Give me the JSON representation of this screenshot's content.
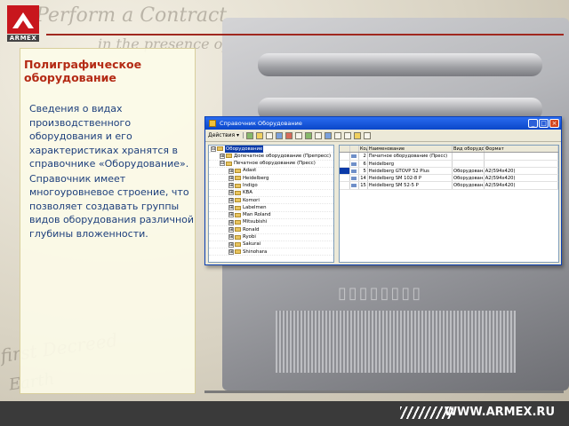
{
  "logo": {
    "name": "ARMEX"
  },
  "slide": {
    "title": "Полиграфическое оборудование",
    "paragraph1": "Сведения о видах производственного оборудования и его характеристиках хранятся в справочнике «Оборудование».",
    "paragraph2": "Справочник имеет многоуровневое строение, что позволяет создавать группы видов оборудования различной глубины вложенности."
  },
  "window": {
    "title": "Справочник Оборудование",
    "controls": [
      "_",
      "□",
      "×"
    ],
    "toolbar": {
      "actions_label": "Действия ▾"
    },
    "tree": [
      {
        "label": "Оборудование",
        "level": 0,
        "toggle": "⊟",
        "selected": true
      },
      {
        "label": "Допечатное оборудование (Препресс)",
        "level": 1,
        "toggle": "⊞"
      },
      {
        "label": "Печатное оборудование (Пресс)",
        "level": 1,
        "toggle": "⊟"
      },
      {
        "label": "Adast",
        "level": 2,
        "toggle": "⊞"
      },
      {
        "label": "Heidelberg",
        "level": 2,
        "toggle": "⊞"
      },
      {
        "label": "Indigo",
        "level": 2,
        "toggle": "⊞"
      },
      {
        "label": "KBA",
        "level": 2,
        "toggle": "⊞"
      },
      {
        "label": "Komori",
        "level": 2,
        "toggle": "⊞"
      },
      {
        "label": "Labelmen",
        "level": 2,
        "toggle": "⊞"
      },
      {
        "label": "Man Roland",
        "level": 2,
        "toggle": "⊞"
      },
      {
        "label": "Mitsubishi",
        "level": 2,
        "toggle": "⊞"
      },
      {
        "label": "Ronald",
        "level": 2,
        "toggle": "⊞"
      },
      {
        "label": "Ryobi",
        "level": 2,
        "toggle": "⊞"
      },
      {
        "label": "Sakurai",
        "level": 2,
        "toggle": "⊞"
      },
      {
        "label": "Shinohara",
        "level": 2,
        "toggle": "⊞"
      }
    ],
    "table": {
      "headers": [
        "",
        "",
        "Код",
        "Наименование",
        "Вид оборудо...",
        "Формат"
      ],
      "rows": [
        {
          "code": "2",
          "name": "Печатное оборудование (Пресс)",
          "type": "",
          "format": "",
          "selected": false
        },
        {
          "code": "6",
          "name": "Heidelberg",
          "type": "",
          "format": "",
          "selected": false
        },
        {
          "code": "5",
          "name": "Heidelberg GTOVP 52 Plus",
          "type": "Оборудован...",
          "format": "A2(594х420)",
          "selected": true
        },
        {
          "code": "14",
          "name": "Heidelberg SM 102-8 P",
          "type": "Оборудован...",
          "format": "A2(594х420)",
          "selected": false
        },
        {
          "code": "15",
          "name": "Heidelberg SM 52-5 P",
          "type": "Оборудован...",
          "format": "A2(594х420)",
          "selected": false
        }
      ]
    }
  },
  "footer": {
    "url": "WWW.ARMEX.RU"
  }
}
